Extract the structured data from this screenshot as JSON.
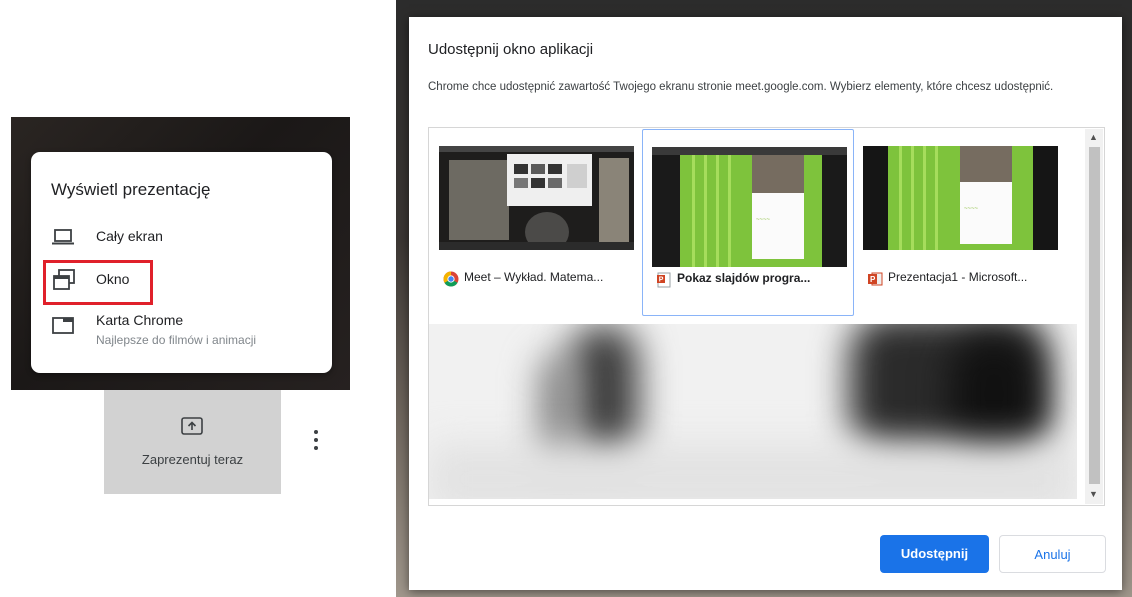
{
  "meet_menu": {
    "title": "Wyświetl prezentację",
    "items": [
      {
        "label": "Cały ekran",
        "icon": "laptop-icon"
      },
      {
        "label": "Okno",
        "icon": "window-icon"
      },
      {
        "label": "Karta Chrome",
        "sublabel": "Najlepsze do filmów i animacji",
        "icon": "chrome-tab-icon"
      }
    ],
    "highlight_color": "#e0202a"
  },
  "present_button": {
    "label": "Zaprezentuj teraz",
    "icon": "present-upload-icon"
  },
  "more_options_icon": "more-vert-icon",
  "dialog": {
    "title": "Udostępnij okno aplikacji",
    "description": "Chrome chce udostępnić zawartość Twojego ekranu stronie meet.google.com. Wybierz elementy, które chcesz udostępnić.",
    "windows": [
      {
        "label": "Meet – Wykład. Matema...",
        "icon": "chrome-icon",
        "selected": false
      },
      {
        "label": "Pokaz slajdów progra...",
        "icon": "powerpoint-slideshow-icon",
        "selected": true
      },
      {
        "label": "Prezentacja1 - Microsoft...",
        "icon": "powerpoint-icon",
        "selected": false
      }
    ],
    "share_button": "Udostępnij",
    "cancel_button": "Anuluj",
    "accent_color": "#1a73e8"
  }
}
